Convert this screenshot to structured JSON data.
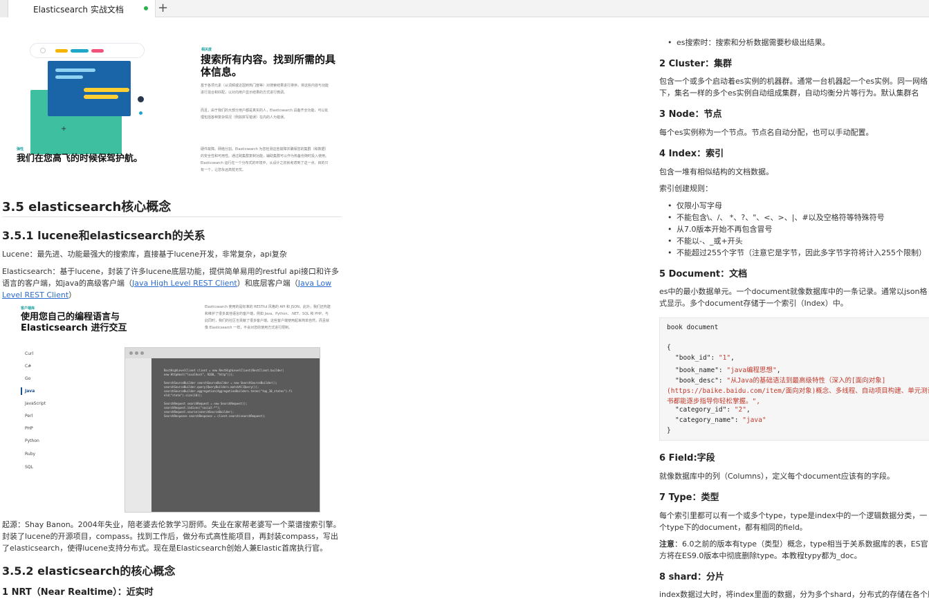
{
  "tab": {
    "title": "Elasticsearch 实战文档",
    "add_label": "+"
  },
  "left": {
    "illus_top": {
      "eyebrow": "相关度",
      "title": "搜索所有内容。找到所需的具体信息。",
      "para1": "基于各项元素（从词频或近因到热门度等）对搜索结果进行排序。将这些内容与功能进行混合和匹配，以对向用户显示结果的方式进行微调。",
      "para2": "而且，由于我们的大部分用户都是真实的人，Elasticsearch 具备齐全功能，可以处理包括各种复杂情况（例如拼写错误）在内的人为错误。",
      "eyebrow2": "弹性",
      "title2": "我们在您高飞的时候保驾护航。",
      "para3": "硬件故障。网络分割。Elasticsearch 为您检测这些故障并确保您的集群（和数据）的安全性和可用性。通过跨集群复制功能，辅助集群可以作为热备份随时投入使用。Elasticsearch 运行在一个分布式的环境中，从设计之初就考虑到了这一点，目的只有一个，让您永远高枕无忧。"
    },
    "h_35": "3.5 elasticsearch核心概念",
    "h_351": "3.5.1 lucene和elasticsearch的关系",
    "p_lucene": "Lucene：最先进、功能最强大的搜索库，直接基于lucene开发，非常复杂，api复杂",
    "p_es_1": "Elasticsearch：基于lucene，封装了许多lucene底层功能，提供简单易用的restful api接口和许多语言的客户端，如java的高级客户端（",
    "link_high": "Java High Level REST Client",
    "p_es_2": "）和底层客户端（",
    "link_low": "Java Low Level REST Client",
    "p_es_3": "）",
    "illus_mid": {
      "eyebrow": "客户端库",
      "title": "使用您自己的编程语言与 Elasticsearch 进行交互",
      "desc": "Elasticsearch 使用的是标准的 RESTful 风格的 API 和 JSON。此外，我们还构建和维护了很多其他语言的客户端，例如 Java、Python、.NET、SQL 和 PHP。与此同时，我们的社区也贡献了很多客户端。这些客户端使用起来简单自然，而且就像 Elasticsearch 一样，不会对您的使用方式进行限制。",
      "languages": [
        "Curl",
        "C#",
        "Go",
        "Java",
        "JavaScript",
        "Perl",
        "PHP",
        "Python",
        "Ruby",
        "SQL"
      ],
      "active_language": "Java",
      "code_lines": [
        "RestHighLevelClient client = new RestHighLevelClient(RestClient.builder(",
        "        new HttpHost(\"localhost\", 9200, \"http\")));",
        "",
        "SearchSourceBuilder searchSourceBuilder = new SearchSourceBuilder();",
        "searchSourceBuilder.query(QueryBuilders.matchAllQuery());",
        "searchSourceBuilder.aggregation(AggregationBuilders.terms(\"top_10_states\").fi",
        "eld(\"state\").size(10));",
        "",
        "SearchRequest searchRequest = new SearchRequest();",
        "searchRequest.indices(\"social-*\");",
        "searchRequest.source(searchSourceBuilder);",
        "SearchResponse searchResponse = client.search(searchRequest);"
      ]
    },
    "p_origin": "起源：Shay Banon。2004年失业，陪老婆去伦敦学习厨师。失业在家帮老婆写一个菜谱搜索引擎。封装了lucene的开源项目，compass。找到工作后，做分布式高性能项目，再封装compass，写出了elasticsearch，使得lucene支持分布式。现在是Elasticsearch创始人兼Elastic首席执行官。",
    "h_352": "3.5.2 elasticsearch的核心概念",
    "h_nrt": "1 NRT（Near Realtime）：近实时"
  },
  "right": {
    "bullet_top": "es搜索时：搜索和分析数据需要秒级出结果。",
    "h_cluster": "2 Cluster：集群",
    "p_cluster": "包含一个或多个启动着es实例的机器群。通常一台机器起一个es实例。同一网络下，集名一样的多个es实例自动组成集群，自动均衡分片等行为。默认集群名为\"elasticsearch\"。",
    "h_node": "3 Node：节点",
    "p_node": "每个es实例称为一个节点。节点名自动分配，也可以手动配置。",
    "h_index": "4 Index：索引",
    "p_index": "包含一堆有相似结构的文档数据。",
    "p_index_rules": "索引创建规则：",
    "index_rules": [
      "仅限小写字母",
      "不能包含\\、/、 *、?、\"、<、>、|、#以及空格符等特殊符号",
      "从7.0版本开始不再包含冒号",
      "不能以-、_或+开头",
      "不能超过255个字节（注意它是字节，因此多字节字符将计入255个限制）"
    ],
    "h_doc": "5 Document：文档",
    "p_doc": "es中的最小数据单元。一个document就像数据库中的一条记录。通常以json格式显示。多个document存储于一个索引（Index）中。",
    "code": {
      "label": "book document",
      "book_id_key": "\"book_id\": ",
      "book_id_val": "\"1\"",
      "book_name_key": "\"book_name\": ",
      "book_name_val": "\"java编程思想\"",
      "book_desc_key": "\"book_desc\": ",
      "book_desc_val1": "\"从Java的基础语法到最高级特性（深入的[面向对象]",
      "book_desc_val2": "(https://baike.baidu.com/item/面向对象)概念、多线程、自动项目构建、单元测试和调试等），本",
      "book_desc_val3": "书都能逐步指导你轻松掌握。\",",
      "category_id_key": "\"category_id\": ",
      "category_id_val": "\"2\"",
      "category_name_key": "\"category_name\": ",
      "category_name_val": "\"java\""
    },
    "h_field": "6 Field:字段",
    "p_field": "就像数据库中的列（Columns），定义每个document应该有的字段。",
    "h_type": "7 Type：类型",
    "p_type": "每个索引里都可以有一个或多个type，type是index中的一个逻辑数据分类，一个type下的document，都有相同的field。",
    "p_note_bold": "注意",
    "p_note": "：6.0之前的版本有type（类型）概念，type相当于关系数据库的表，ES官方将在ES9.0版本中彻底删除type。本教程typy都为_doc。",
    "h_shard": "8 shard：分片",
    "p_shard": "index数据过大时，将index里面的数据，分为多个shard，分布式的存储在各个服务器上面。"
  }
}
